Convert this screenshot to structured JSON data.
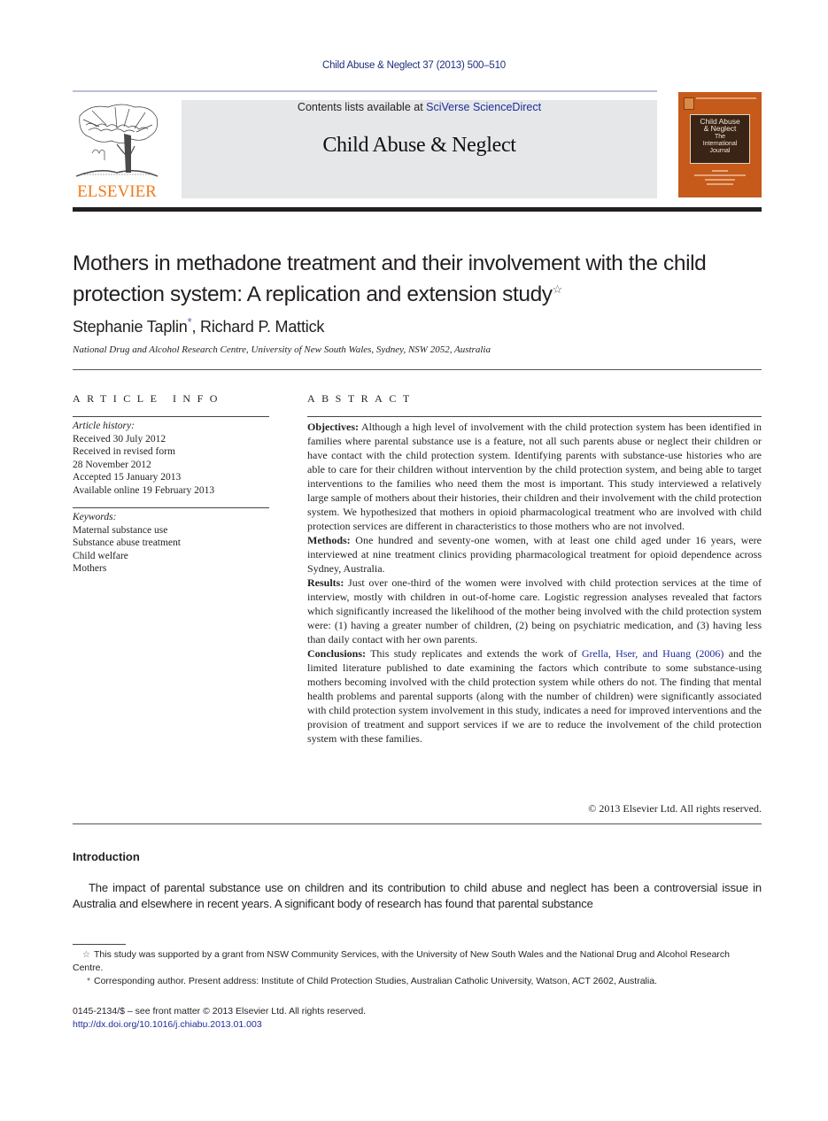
{
  "header": {
    "running_head": "Child Abuse & Neglect 37 (2013) 500–510",
    "contents_prefix": "Contents lists available at ",
    "contents_link": "SciVerse ScienceDirect",
    "journal_name": "Child Abuse & Neglect",
    "publisher_logo_text": "ELSEVIER",
    "cover": {
      "line1": "Child Abuse",
      "line2": "& Neglect",
      "line3": "The",
      "line4": "International",
      "line5": "Journal",
      "background_color": "#c55a1b"
    }
  },
  "article": {
    "title": "Mothers in methadone treatment and their involvement with the child protection system: A replication and extension study",
    "title_note_mark": "☆",
    "authors": [
      {
        "name": "Stephanie Taplin",
        "mark": "*"
      },
      {
        "name": "Richard P. Mattick",
        "mark": ""
      }
    ],
    "author_separator": ", ",
    "affiliation": "National Drug and Alcohol Research Centre, University of New South Wales, Sydney, NSW 2052, Australia"
  },
  "article_info": {
    "heading": "ARTICLE INFO",
    "history_label": "Article history:",
    "history": [
      "Received 30 July 2012",
      "Received in revised form",
      "28 November 2012",
      "Accepted 15 January 2013",
      "Available online 19 February 2013"
    ],
    "keywords_label": "Keywords:",
    "keywords": [
      "Maternal substance use",
      "Substance abuse treatment",
      "Child welfare",
      "Mothers"
    ]
  },
  "abstract": {
    "heading": "ABSTRACT",
    "objectives_label": "Objectives:",
    "objectives": " Although a high level of involvement with the child protection system has been identified in families where parental substance use is a feature, not all such parents abuse or neglect their children or have contact with the child protection system. Identifying parents with substance-use histories who are able to care for their children without intervention by the child protection system, and being able to target interventions to the families who need them the most is important. This study interviewed a relatively large sample of mothers about their histories, their children and their involvement with the child protection system. We hypothesized that mothers in opioid pharmacological treatment who are involved with child protection services are different in characteristics to those mothers who are not involved.",
    "methods_label": "Methods:",
    "methods": " One hundred and seventy-one women, with at least one child aged under 16 years, were interviewed at nine treatment clinics providing pharmacological treatment for opioid dependence across Sydney, Australia.",
    "results_label": "Results:",
    "results": " Just over one-third of the women were involved with child protection services at the time of interview, mostly with children in out-of-home care. Logistic regression analyses revealed that factors which significantly increased the likelihood of the mother being involved with the child protection system were: (1) having a greater number of children, (2) being on psychiatric medication, and (3) having less than daily contact with her own parents.",
    "conclusions_label": "Conclusions:",
    "conclusions_pre": " This study replicates and extends the work of ",
    "conclusions_link": "Grella, Hser, and Huang (2006)",
    "conclusions_post": " and the limited literature published to date examining the factors which contribute to some substance-using mothers becoming involved with the child protection system while others do not. The finding that mental health problems and parental supports (along with the number of children) were significantly associated with child protection system involvement in this study, indicates a need for improved interventions and the provision of treatment and support services if we are to reduce the involvement of the child protection system with these families.",
    "copyright": "© 2013 Elsevier Ltd. All rights reserved."
  },
  "introduction": {
    "heading": "Introduction",
    "paragraph": "The impact of parental substance use on children and its contribution to child abuse and neglect has been a controversial issue in Australia and elsewhere in recent years. A significant body of research has found that parental substance"
  },
  "footnotes": {
    "funding_mark": "☆",
    "funding": "This study was supported by a grant from NSW Community Services, with the University of New South Wales and the National Drug and Alcohol Research Centre.",
    "corresponding_mark": "*",
    "corresponding": "Corresponding author. Present address: Institute of Child Protection Studies, Australian Catholic University, Watson, ACT 2602, Australia.",
    "issn": "0145-2134/$ – see front matter © 2013 Elsevier Ltd. All rights reserved.",
    "doi": "http://dx.doi.org/10.1016/j.chiabu.2013.01.003"
  }
}
